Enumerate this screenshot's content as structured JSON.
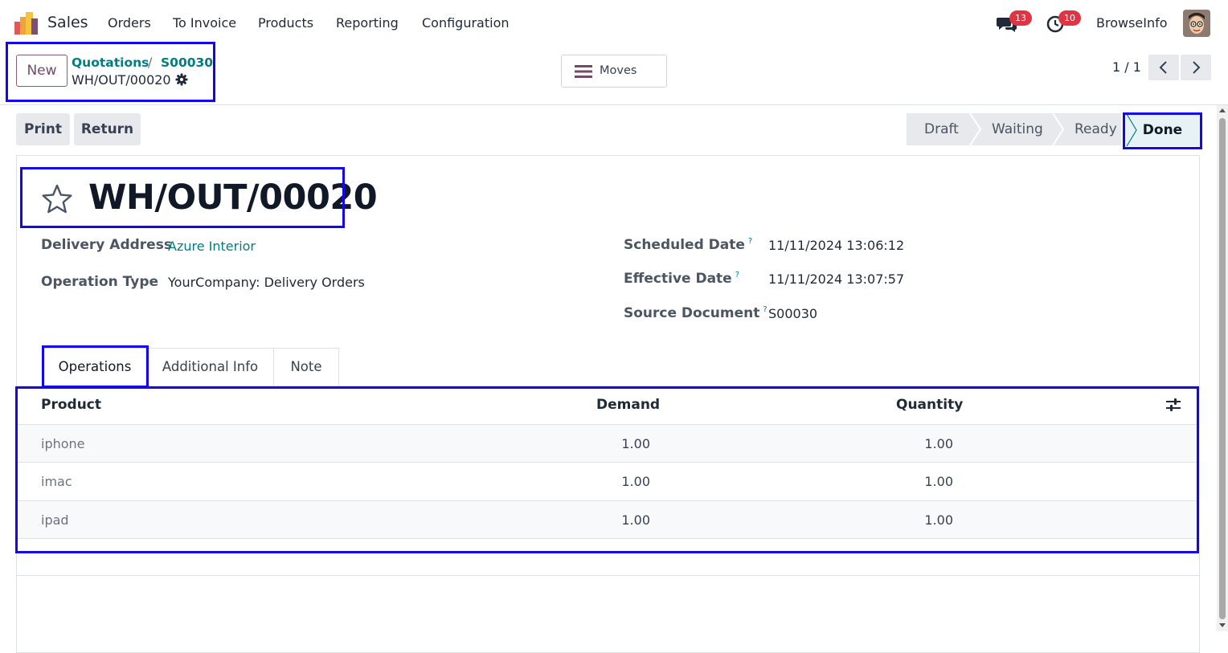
{
  "nav": {
    "app_name": "Sales",
    "menu": [
      "Orders",
      "To Invoice",
      "Products",
      "Reporting",
      "Configuration"
    ],
    "messages_count": "13",
    "activities_count": "10",
    "user_name": "BrowseInfo"
  },
  "control_panel": {
    "new_label": "New",
    "breadcrumb": [
      "Quotations",
      "S00030"
    ],
    "breadcrumb_separator": "/",
    "current_record": "WH/OUT/00020",
    "moves_label": "Moves",
    "pager": "1 / 1"
  },
  "actions": {
    "print_label": "Print",
    "return_label": "Return"
  },
  "status_bar": {
    "stages": [
      "Draft",
      "Waiting",
      "Ready",
      "Done"
    ],
    "current": "Done"
  },
  "form": {
    "title": "WH/OUT/00020",
    "fields_left": [
      {
        "label": "Delivery Address",
        "value": "Azure Interior"
      },
      {
        "label": "Operation Type",
        "value": "YourCompany: Delivery Orders"
      }
    ],
    "fields_right": [
      {
        "label": "Scheduled Date",
        "value": "11/11/2024 13:06:12"
      },
      {
        "label": "Effective Date",
        "value": "11/11/2024 13:07:57"
      },
      {
        "label": "Source Document",
        "value": "S00030"
      }
    ],
    "help_mark": "?"
  },
  "tabs": [
    "Operations",
    "Additional Info",
    "Note"
  ],
  "active_tab": "Operations",
  "operations": {
    "columns": [
      "Product",
      "Demand",
      "Quantity"
    ],
    "rows": [
      {
        "product": "iphone",
        "demand": "1.00",
        "quantity": "1.00"
      },
      {
        "product": "imac",
        "demand": "1.00",
        "quantity": "1.00"
      },
      {
        "product": "ipad",
        "demand": "1.00",
        "quantity": "1.00"
      }
    ]
  },
  "colors": {
    "brand": "#714b67",
    "link": "#017e84",
    "badge": "#e03444",
    "highlight": "#1408e8"
  }
}
